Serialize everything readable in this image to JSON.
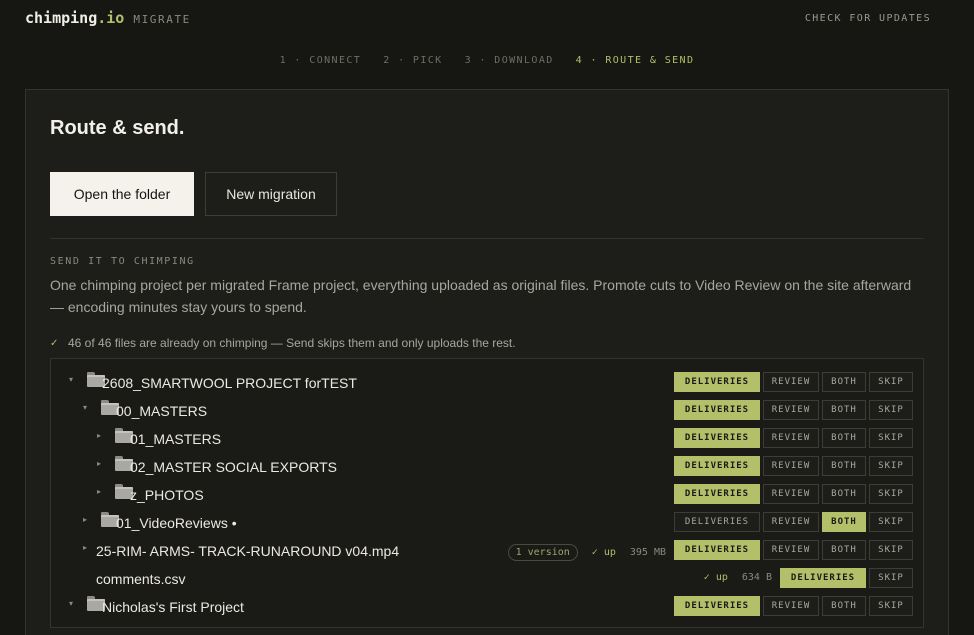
{
  "brand": {
    "name": "chimping",
    "tld": ".io",
    "subtitle": "MIGRATE"
  },
  "header": {
    "check_updates": "CHECK FOR UPDATES"
  },
  "steps": [
    {
      "label": "1 · CONNECT",
      "active": false
    },
    {
      "label": "2 · PICK",
      "active": false
    },
    {
      "label": "3 · DOWNLOAD",
      "active": false
    },
    {
      "label": "4 · ROUTE & SEND",
      "active": true
    }
  ],
  "panel": {
    "title": "Route & send.",
    "open_folder": "Open the folder",
    "new_migration": "New migration",
    "section_label": "SEND IT TO CHIMPING",
    "section_desc": "One chimping project per migrated Frame project, everything uploaded as original files. Promote cuts to Video Review on the site afterward — encoding minutes stay yours to spend.",
    "notice_check": "✓",
    "notice": "46 of 46 files are already on chimping — Send skips them and only uploads the rest."
  },
  "route_labels": {
    "deliveries": "DELIVERIES",
    "review": "REVIEW",
    "both": "BOTH",
    "skip": "SKIP"
  },
  "tree": [
    {
      "name": "2608_SMARTWOOL PROJECT forTEST",
      "chevron": "▾",
      "folder": true,
      "selected": "deliveries"
    },
    {
      "name": "00_MASTERS",
      "chevron": "▾",
      "folder": true,
      "selected": "deliveries"
    },
    {
      "name": "01_MASTERS",
      "chevron": "▸",
      "folder": true,
      "selected": "deliveries"
    },
    {
      "name": "02_MASTER SOCIAL EXPORTS",
      "chevron": "▸",
      "folder": true,
      "selected": "deliveries"
    },
    {
      "name": "z_PHOTOS",
      "chevron": "▸",
      "folder": true,
      "selected": "deliveries"
    },
    {
      "name": "01_VideoReviews •",
      "chevron": "▸",
      "folder": true,
      "selected": "both"
    },
    {
      "name": "25-RIM- ARMS- TRACK-RUNAROUND v04.mp4",
      "chevron": "▸",
      "folder": false,
      "selected": "deliveries",
      "badge": "1 version",
      "up": "✓ up",
      "size": "395 MB"
    },
    {
      "name": "comments.csv",
      "chevron": "",
      "folder": false,
      "selected": "deliveries",
      "up": "✓ up",
      "size": "634 B",
      "two_options": true
    },
    {
      "name": "Nicholas's First Project",
      "chevron": "▾",
      "folder": true,
      "selected": "deliveries"
    }
  ],
  "colors": {
    "accent": "#b4bf6a",
    "background": "#161613",
    "panel": "#1d1d1a"
  }
}
